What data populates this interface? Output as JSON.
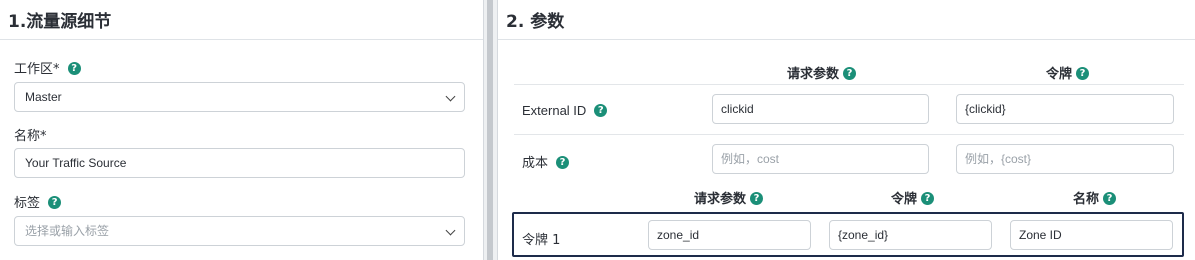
{
  "left_panel": {
    "title": "1.流量源细节",
    "workspace": {
      "label": "工作区*",
      "value": "Master"
    },
    "name": {
      "label": "名称*",
      "value": "Your Traffic Source"
    },
    "tags": {
      "label": "标签",
      "placeholder": "选择或输入标签"
    }
  },
  "right_panel": {
    "title": "2. 参数",
    "columns": {
      "request_param": "请求参数",
      "token": "令牌"
    },
    "rows": [
      {
        "label": "External ID",
        "param_value": "clickid",
        "token_value": "{clickid}"
      },
      {
        "label": "成本",
        "param_placeholder": "例如，cost",
        "token_placeholder": "例如，{cost}"
      }
    ],
    "custom_columns": {
      "request_param": "请求参数",
      "token": "令牌",
      "name": "名称"
    },
    "custom_rows": [
      {
        "label": "令牌 1",
        "param_value": "zone_id",
        "token_value": "{zone_id}",
        "name_value": "Zone ID"
      }
    ]
  },
  "icons": {
    "help": "question-circle-icon",
    "dropdown": "chevron-down-icon"
  },
  "colors": {
    "help_icon": "#1b8f78",
    "focus_border": "#1d2b4a"
  }
}
